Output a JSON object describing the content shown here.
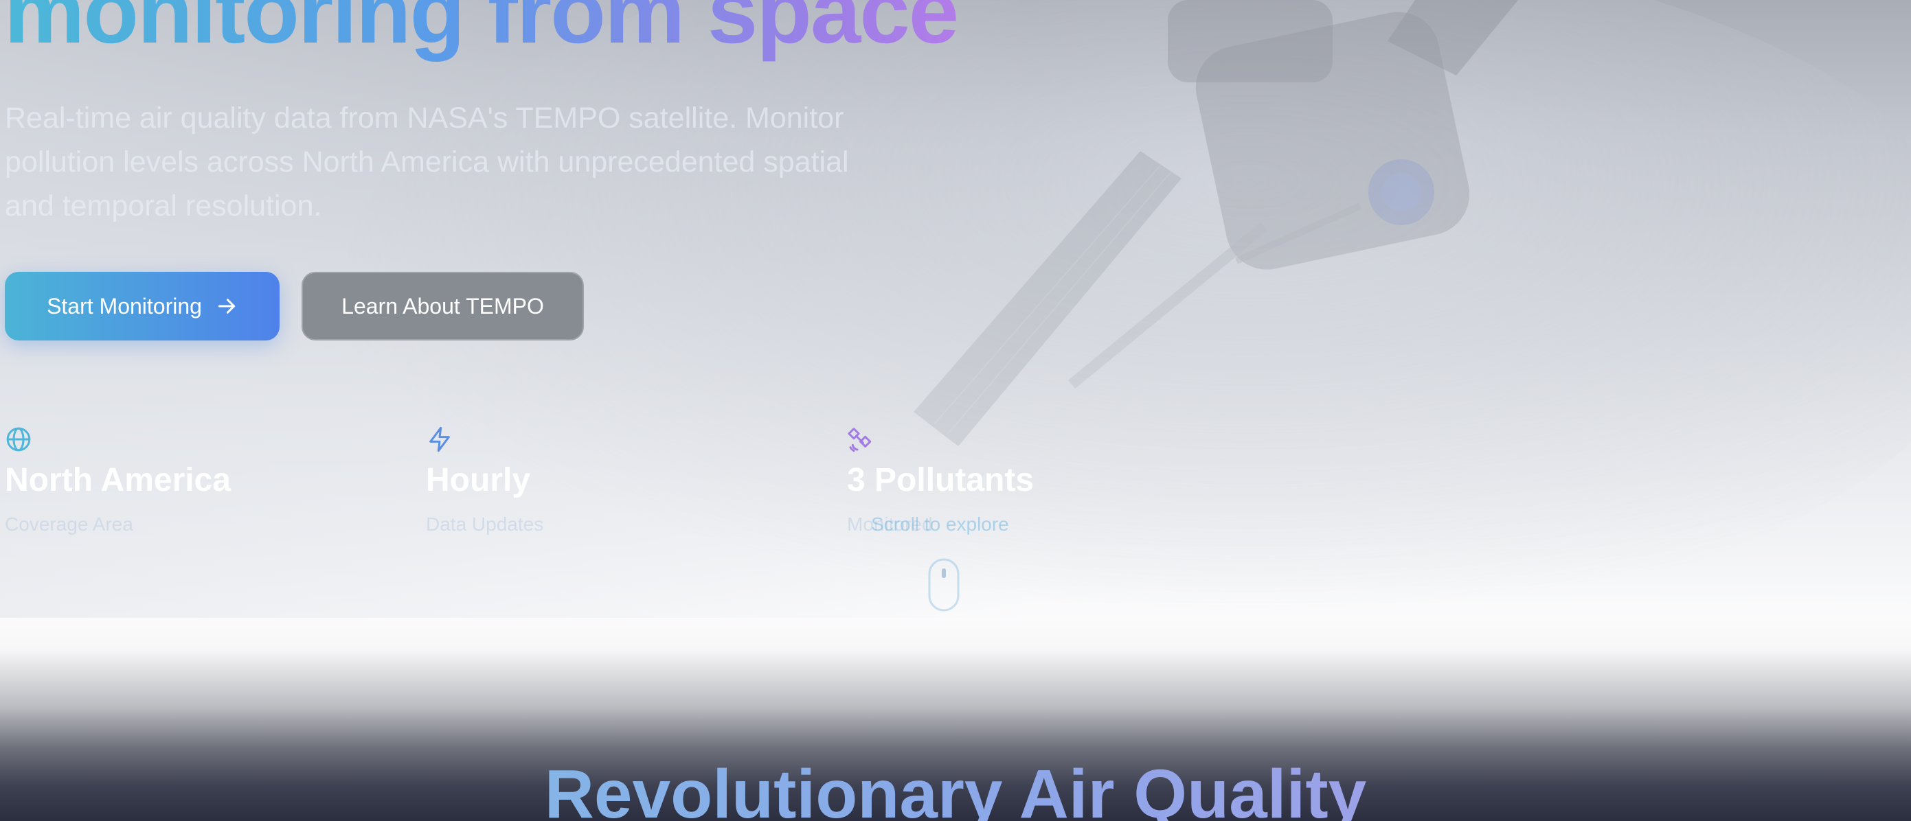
{
  "hero": {
    "headline": "monitoring from space",
    "subtitle": "Real-time air quality data from NASA's TEMPO satellite. Monitor pollution levels across North America with unprecedented spatial and temporal resolution.",
    "primary_button": "Start Monitoring",
    "secondary_button": "Learn About TEMPO",
    "stats": [
      {
        "icon": "globe-icon",
        "value": "North America",
        "label": "Coverage Area"
      },
      {
        "icon": "lightning-icon",
        "value": "Hourly",
        "label": "Data Updates"
      },
      {
        "icon": "satellite-icon",
        "value": "3 Pollutants",
        "label": "Monitored"
      }
    ],
    "scroll_hint": "Scroll to explore"
  },
  "next_section": {
    "title": "Revolutionary Air Quality"
  },
  "colors": {
    "accent_start": "#4cb4d6",
    "accent_end": "#4f82ea",
    "purple": "#b27ce8"
  }
}
